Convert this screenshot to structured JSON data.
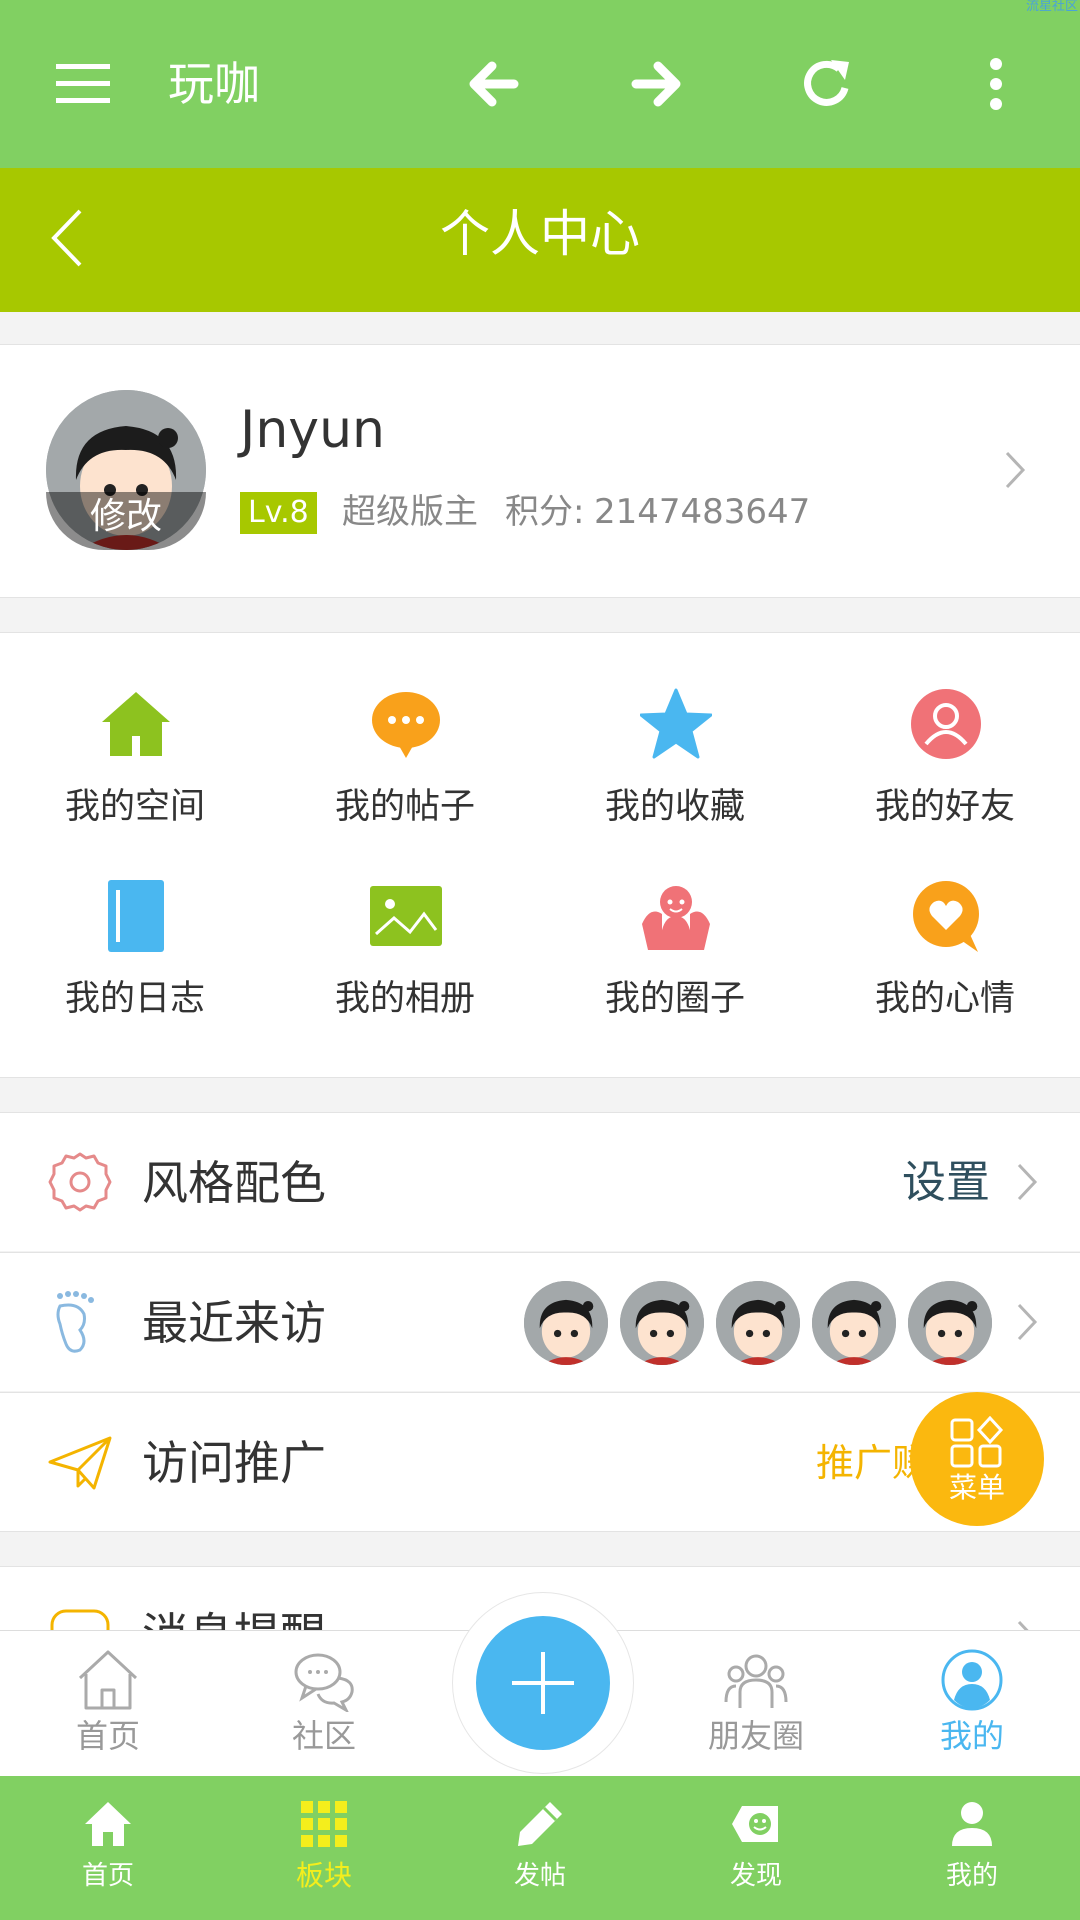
{
  "watermark": "流星社区",
  "appbar": {
    "title": "玩咖",
    "icons": [
      "menu-icon",
      "arrow-left-icon",
      "arrow-right-icon",
      "refresh-icon",
      "more-vertical-icon"
    ]
  },
  "header": {
    "title": "个人中心"
  },
  "profile": {
    "avatar_edit_label": "修改",
    "username": "Jnyun",
    "level": "Lv.8",
    "role": "超级版主",
    "points_label": "积分:",
    "points_value": "2147483647"
  },
  "grid": [
    {
      "label": "我的空间",
      "icon": "home-icon",
      "color": "#8dc21f"
    },
    {
      "label": "我的帖子",
      "icon": "chat-bubble-icon",
      "color": "#f9a11b"
    },
    {
      "label": "我的收藏",
      "icon": "star-icon",
      "color": "#4ab7f0"
    },
    {
      "label": "我的好友",
      "icon": "user-circle-icon",
      "color": "#f07277"
    },
    {
      "label": "我的日志",
      "icon": "notebook-icon",
      "color": "#4ab7f0"
    },
    {
      "label": "我的相册",
      "icon": "image-icon",
      "color": "#8dc21f"
    },
    {
      "label": "我的圈子",
      "icon": "group-icon",
      "color": "#f07277"
    },
    {
      "label": "我的心情",
      "icon": "heart-bubble-icon",
      "color": "#f9a11b"
    }
  ],
  "list": {
    "style": {
      "label": "风格配色",
      "value": "设置",
      "icon": "gear-icon"
    },
    "visitors": {
      "label": "最近来访",
      "icon": "footprint-icon"
    },
    "promote": {
      "label": "访问推广",
      "value": "推广赚",
      "icon": "paper-plane-icon"
    },
    "messages": {
      "label": "消息提醒",
      "icon": "message-icon"
    }
  },
  "float_menu": {
    "label": "菜单",
    "icon": "apps-icon"
  },
  "tabbar": [
    {
      "label": "首页",
      "icon": "home-outline-icon"
    },
    {
      "label": "社区",
      "icon": "chat-outline-icon"
    },
    {
      "label": "",
      "icon": "plus-icon"
    },
    {
      "label": "朋友圈",
      "icon": "friends-outline-icon"
    },
    {
      "label": "我的",
      "icon": "user-outline-icon",
      "active": true
    }
  ],
  "navbar": [
    {
      "label": "首页",
      "icon": "home-solid-icon"
    },
    {
      "label": "板块",
      "icon": "grid-icon",
      "active": true
    },
    {
      "label": "发帖",
      "icon": "pencil-icon"
    },
    {
      "label": "发现",
      "icon": "discover-tag-icon"
    },
    {
      "label": "我的",
      "icon": "user-solid-icon"
    }
  ],
  "colors": {
    "appbar": "#81d062",
    "header": "#a7c800",
    "accent_blue": "#4ab7f0",
    "accent_yellow": "#fbb80f",
    "nav_active": "#f4ee1c"
  }
}
